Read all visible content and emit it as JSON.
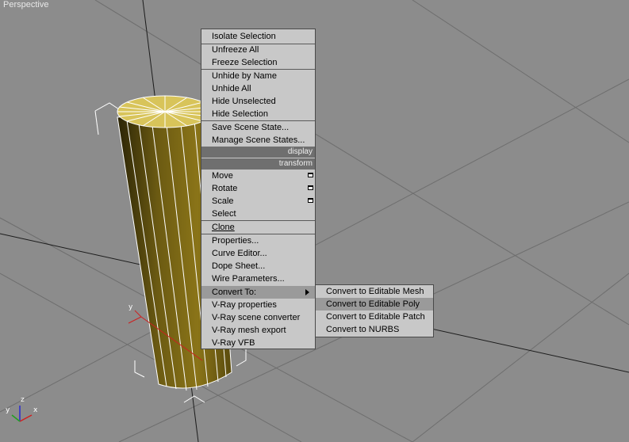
{
  "viewport": {
    "label": "Perspective"
  },
  "axis": {
    "x": "x",
    "y": "y",
    "z": "z"
  },
  "gizmo": {
    "y": "y"
  },
  "quad_menu": {
    "display_header": "display",
    "transform_header": "transform",
    "items": [
      "Isolate Selection",
      "Unfreeze All",
      "Freeze Selection",
      "Unhide by Name",
      "Unhide All",
      "Hide Unselected",
      "Hide Selection",
      "Save Scene State...",
      "Manage Scene States...",
      "Move",
      "Rotate",
      "Scale",
      "Select",
      "Clone",
      "Properties...",
      "Curve Editor...",
      "Dope Sheet...",
      "Wire Parameters...",
      "Convert To:",
      "V-Ray properties",
      "V-Ray scene converter",
      "V-Ray mesh export",
      "V-Ray VFB"
    ]
  },
  "submenu": {
    "items": [
      "Convert to Editable Mesh",
      "Convert to Editable Poly",
      "Convert to Editable Patch",
      "Convert to NURBS"
    ]
  }
}
